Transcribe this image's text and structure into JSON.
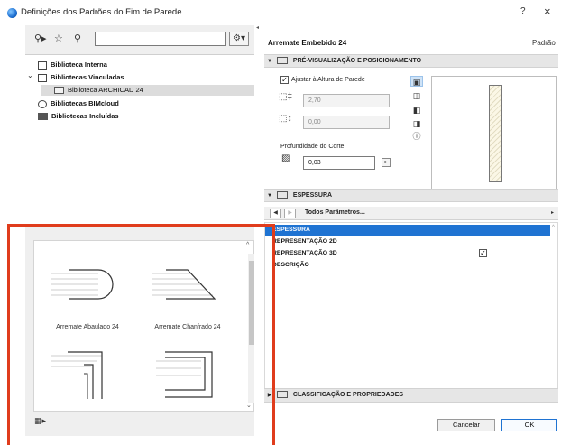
{
  "window": {
    "title": "Definições dos Padrões do Fim de Parede",
    "help": "?",
    "close": "×"
  },
  "library": {
    "search_placeholder": "",
    "tree": [
      {
        "label": "Biblioteca Interna"
      },
      {
        "label": "Bibliotecas Vinculadas",
        "expanded": true
      },
      {
        "label": "Biblioteca ARCHICAD 24",
        "selected": true
      },
      {
        "label": "Bibliotecas BIMcloud"
      },
      {
        "label": "Bibliotecas Incluídas"
      }
    ],
    "thumbnails": [
      {
        "label": "Arremate Abaulado 24"
      },
      {
        "label": "Arremate Chanfrado 24"
      },
      {
        "label": ""
      },
      {
        "label": ""
      }
    ]
  },
  "header": {
    "title": "Arremate Embebido 24",
    "right": "Padrão"
  },
  "preview_section": {
    "title": "PRÉ-VISUALIZAÇÃO E POSICIONAMENTO",
    "checkbox_label": "Ajustar à Altura de Parede",
    "checkbox_checked": true,
    "field1": "2,70",
    "field2": "0,00",
    "depth_label": "Profundidade do Corte:",
    "depth_value": "0,03"
  },
  "thickness_section": {
    "title": "ESPESSURA",
    "nav_label": "Todos Parâmetros...",
    "params": [
      {
        "label": "ESPESSURA",
        "selected": true
      },
      {
        "label": "REPRESENTAÇÃO 2D"
      },
      {
        "label": "REPRESENTAÇÃO 3D",
        "checked": true
      },
      {
        "label": "DESCRIÇÃO"
      }
    ]
  },
  "classification_section": {
    "title": "CLASSIFICAÇÃO E PROPRIEDADES"
  },
  "buttons": {
    "cancel": "Cancelar",
    "ok": "OK"
  },
  "colors": {
    "accent": "#1f73d2",
    "highlight_frame": "#e03c1c"
  }
}
